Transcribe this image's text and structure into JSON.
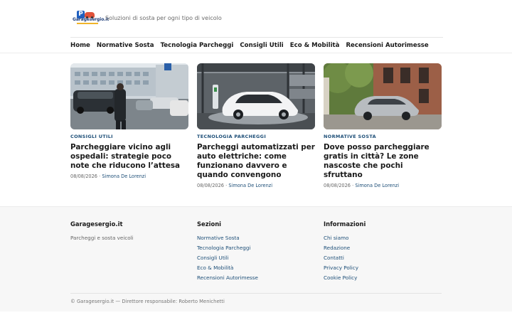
{
  "header": {
    "logo_text": "Garagesergio.it",
    "tagline": "Soluzioni di sosta per ogni tipo di veicolo"
  },
  "nav": {
    "items": [
      "Home",
      "Normative Sosta",
      "Tecnologia Parcheggi",
      "Consigli Utili",
      "Eco & Mobilità",
      "Recensioni Autorimesse"
    ]
  },
  "articles": [
    {
      "category": "CONSIGLI UTILI",
      "title": "Parcheggiare vicino agli ospedali: strategie poco note che riducono l’attesa",
      "date": "08/08/2026",
      "author": "Simona De Lorenzi"
    },
    {
      "category": "TECNOLOGIA PARCHEGGI",
      "title": "Parcheggi automatizzati per auto elettriche: come funzionano davvero e quando convengono",
      "date": "08/08/2026",
      "author": "Simona De Lorenzi"
    },
    {
      "category": "NORMATIVE SOSTA",
      "title": "Dove posso parcheggiare gratis in città? Le zone nascoste che pochi sfruttano",
      "date": "08/08/2026",
      "author": "Simona De Lorenzi"
    }
  ],
  "footer": {
    "about": {
      "heading": "Garagesergio.it",
      "description": "Parcheggi e sosta veicoli"
    },
    "sections": {
      "heading": "Sezioni",
      "links": [
        "Normative Sosta",
        "Tecnologia Parcheggi",
        "Consigli Utili",
        "Eco & Mobilità",
        "Recensioni Autorimesse"
      ]
    },
    "info": {
      "heading": "Informazioni",
      "links": [
        "Chi siamo",
        "Redazione",
        "Contatti",
        "Privacy Policy",
        "Cookie Policy"
      ]
    },
    "copyright": "© Garagesergio.it — Direttore responsabile: Roberto Menichetti"
  },
  "colors": {
    "accent": "#1e4f78",
    "footer_bg": "#f7f7f7"
  }
}
